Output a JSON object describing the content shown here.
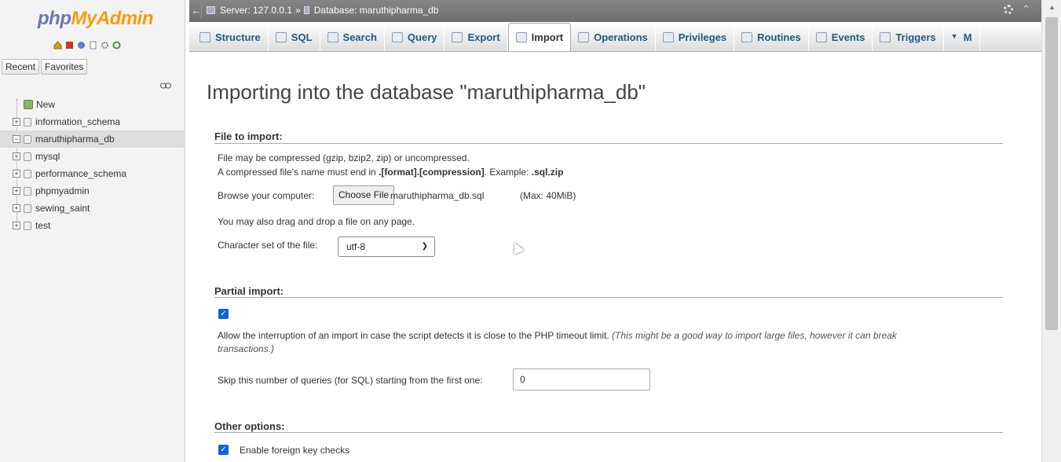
{
  "nav": {
    "logo_part1": "php",
    "logo_part2": "MyAdmin",
    "recent_label": "Recent",
    "favorites_label": "Favorites",
    "new_label": "New",
    "databases": [
      {
        "name": "information_schema",
        "selected": false
      },
      {
        "name": "maruthipharma_db",
        "selected": true
      },
      {
        "name": "mysql",
        "selected": false
      },
      {
        "name": "performance_schema",
        "selected": false
      },
      {
        "name": "phpmyadmin",
        "selected": false
      },
      {
        "name": "sewing_saint",
        "selected": false
      },
      {
        "name": "test",
        "selected": false
      }
    ]
  },
  "topbar": {
    "server": "Server: 127.0.0.1",
    "separator": "»",
    "database": "Database: maruthipharma_db"
  },
  "tabs": [
    {
      "label": "Structure",
      "icon": "structure-icon",
      "active": false
    },
    {
      "label": "SQL",
      "icon": "sql-icon",
      "active": false
    },
    {
      "label": "Search",
      "icon": "search-icon",
      "active": false
    },
    {
      "label": "Query",
      "icon": "query-icon",
      "active": false
    },
    {
      "label": "Export",
      "icon": "export-icon",
      "active": false
    },
    {
      "label": "Import",
      "icon": "import-icon",
      "active": true
    },
    {
      "label": "Operations",
      "icon": "wrench-icon",
      "active": false
    },
    {
      "label": "Privileges",
      "icon": "privileges-icon",
      "active": false
    },
    {
      "label": "Routines",
      "icon": "routines-icon",
      "active": false
    },
    {
      "label": "Events",
      "icon": "clock-icon",
      "active": false
    },
    {
      "label": "Triggers",
      "icon": "triggers-icon",
      "active": false
    },
    {
      "label": "M",
      "icon": "more-menu-icon",
      "active": false
    }
  ],
  "main": {
    "title": "Importing into the database \"maruthipharma_db\"",
    "file_section": {
      "heading": "File to import:",
      "line1": "File may be compressed (gzip, bzip2, zip) or uncompressed.",
      "line2_prefix": "A compressed file's name must end in ",
      "line2_bold": ".[format].[compression]",
      "line2_mid": ". Example: ",
      "line2_example": ".sql.zip",
      "browse_label": "Browse your computer:",
      "choose_file_label": "Choose File",
      "file_name": "maruthipharma_db.sql",
      "max_size": "(Max: 40MiB)",
      "drag_hint": "You may also drag and drop a file on any page.",
      "charset_label": "Character set of the file:",
      "charset_value": "utf-8"
    },
    "partial_section": {
      "heading": "Partial import:",
      "allow_interrupt_checked": true,
      "allow_interrupt_text": "Allow the interruption of an import in case the script detects it is close to the PHP timeout limit.",
      "allow_interrupt_note_1": "(This might be a good way to import large files, however it can break",
      "allow_interrupt_note_2": "transactions.)",
      "skip_label": "Skip this number of queries (for SQL) starting from the first one:",
      "skip_value": "0"
    },
    "other_section": {
      "heading": "Other options:",
      "foreign_key_checked": true,
      "foreign_key_label": "Enable foreign key checks"
    }
  },
  "colors": {
    "accent_blue": "#235a81",
    "checkbox_blue": "#0b64d2",
    "logo_blue": "#6c78af",
    "logo_orange": "#f89c0e"
  }
}
